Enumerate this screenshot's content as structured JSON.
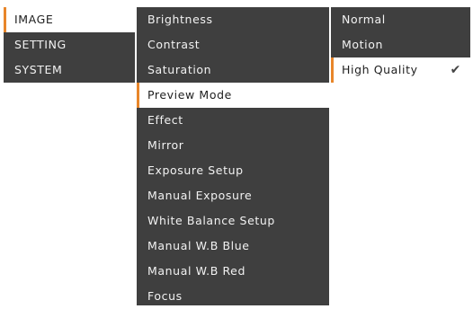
{
  "accent_color": "#e8862a",
  "menu_bg_color": "#3f3f3f",
  "main_menu": {
    "items": [
      {
        "label": "IMAGE",
        "selected": true
      },
      {
        "label": "SETTING",
        "selected": false
      },
      {
        "label": "SYSTEM",
        "selected": false
      }
    ]
  },
  "image_menu": {
    "items": [
      {
        "label": "Brightness",
        "selected": false
      },
      {
        "label": "Contrast",
        "selected": false
      },
      {
        "label": "Saturation",
        "selected": false
      },
      {
        "label": "Preview Mode",
        "selected": true
      },
      {
        "label": "Effect",
        "selected": false
      },
      {
        "label": "Mirror",
        "selected": false
      },
      {
        "label": "Exposure Setup",
        "selected": false
      },
      {
        "label": "Manual Exposure",
        "selected": false
      },
      {
        "label": "White Balance Setup",
        "selected": false
      },
      {
        "label": "Manual W.B Blue",
        "selected": false
      },
      {
        "label": "Manual W.B Red",
        "selected": false
      },
      {
        "label": "Focus",
        "selected": false
      }
    ]
  },
  "preview_mode_menu": {
    "items": [
      {
        "label": "Normal",
        "selected": false
      },
      {
        "label": "Motion",
        "selected": false
      },
      {
        "label": "High Quality",
        "selected": true,
        "check_icon": "checkmark-icon",
        "check_glyph": "✔"
      }
    ]
  }
}
